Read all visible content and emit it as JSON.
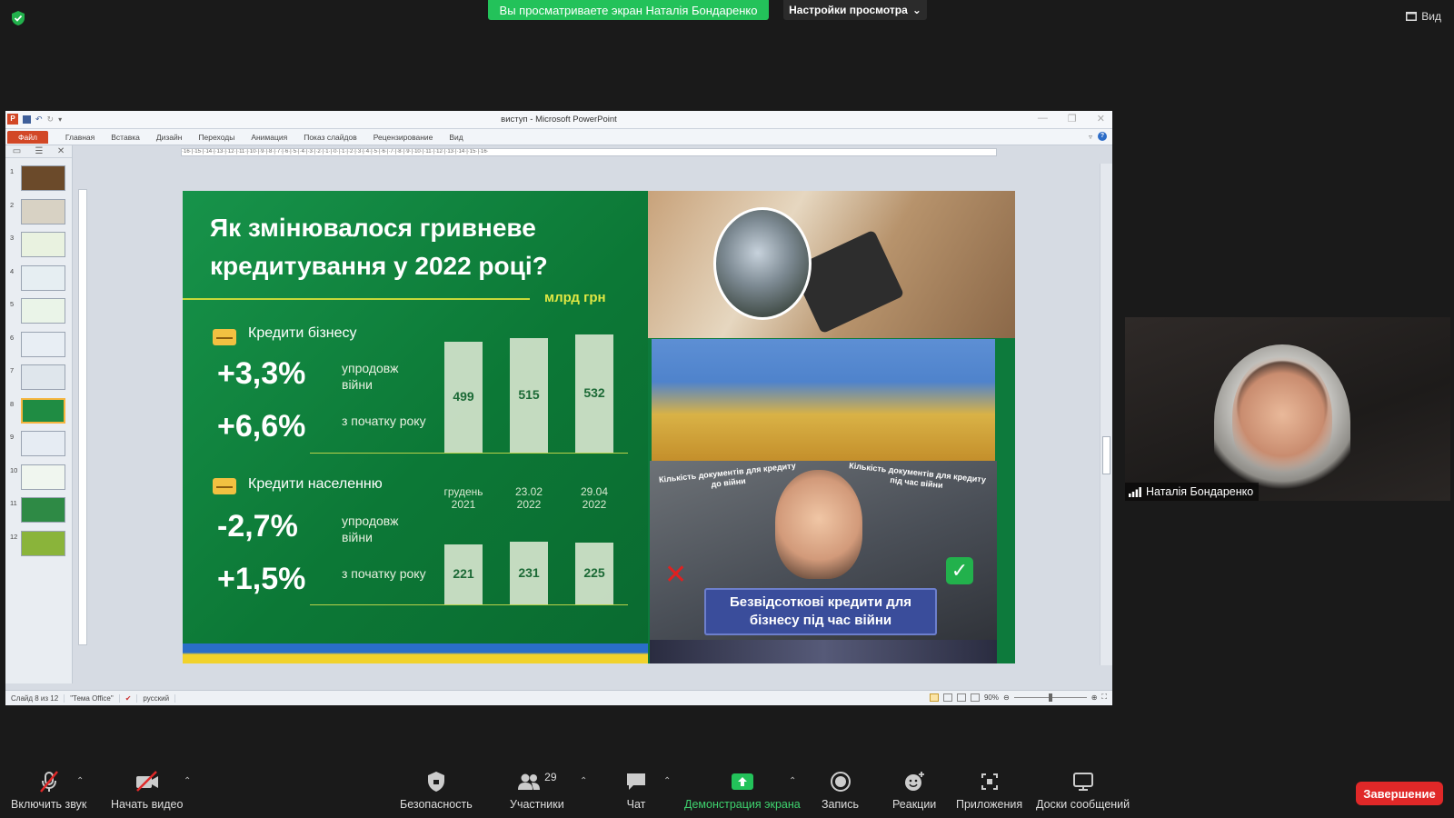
{
  "zoom": {
    "banner": "Вы просматриваете экран Наталія Бондаренко",
    "view_settings": "Настройки просмотра",
    "view_button": "Вид",
    "end_button": "Завершение",
    "participant_count": "29",
    "toolbar": {
      "mute": "Включить звук",
      "video": "Начать видео",
      "security": "Безопасность",
      "participants": "Участники",
      "chat": "Чат",
      "share": "Демонстрация экрана",
      "record": "Запись",
      "reactions": "Реакции",
      "apps": "Приложения",
      "whiteboards": "Доски сообщений"
    },
    "speaker_name": "Наталія Бондаренко"
  },
  "ppt": {
    "window_title": "виступ - Microsoft PowerPoint",
    "tabs": [
      "Файл",
      "Главная",
      "Вставка",
      "Дизайн",
      "Переходы",
      "Анимация",
      "Показ слайдов",
      "Рецензирование",
      "Вид"
    ],
    "status": {
      "slide": "Слайд 8 из 12",
      "theme": "\"Тема Office\"",
      "language": "русский",
      "zoom": "90%"
    },
    "thumbnails": [
      "1",
      "2",
      "3",
      "4",
      "5",
      "6",
      "7",
      "8",
      "9",
      "10",
      "11",
      "12"
    ],
    "active_thumbnail": 8,
    "ruler_text": "·16·|·15·|·14·|·13·|·12·|·11·|·10·|·9·|·8·|·7·|·6·|·5·|·4·|·3·|·2·|·1·|·0·|·1·|·2·|·3·|·4·|·5·|·6·|·7·|·8·|·9·|·10·|·11·|·12·|·13·|·14·|·15·|·16·"
  },
  "slide": {
    "title_line1": "Як змінювалося гривневе",
    "title_line2": "кредитування у 2022 році?",
    "unit": "млрд грн",
    "business": {
      "label": "Кредити бізнесу",
      "pct_war": "+3,3%",
      "pct_war_note": "упродовж війни",
      "pct_year": "+6,6%",
      "pct_year_note": "з початку року"
    },
    "households": {
      "label": "Кредити населенню",
      "pct_war": "-2,7%",
      "pct_war_note": "упродовж війни",
      "pct_year": "+1,5%",
      "pct_year_note": "з початку року"
    },
    "image_captions": {
      "left": "Кількість документів для кредиту до війни",
      "right": "Кількість документів для кредиту під час війни",
      "banner": "Безвідсоткові кредити для бізнесу під час війни"
    }
  },
  "chart_data": [
    {
      "type": "bar",
      "categories": [
        "грудень 2021",
        "23.02 2022",
        "29.04 2022"
      ],
      "values": [
        499,
        515,
        532
      ],
      "title": "Кредити бізнесу",
      "ylabel": "млрд грн",
      "ylim": [
        0,
        540
      ]
    },
    {
      "type": "bar",
      "categories": [
        "грудень 2021",
        "23.02 2022",
        "29.04 2022"
      ],
      "values": [
        221,
        231,
        225
      ],
      "title": "Кредити населенню",
      "ylabel": "млрд грн",
      "ylim": [
        0,
        240
      ]
    }
  ]
}
